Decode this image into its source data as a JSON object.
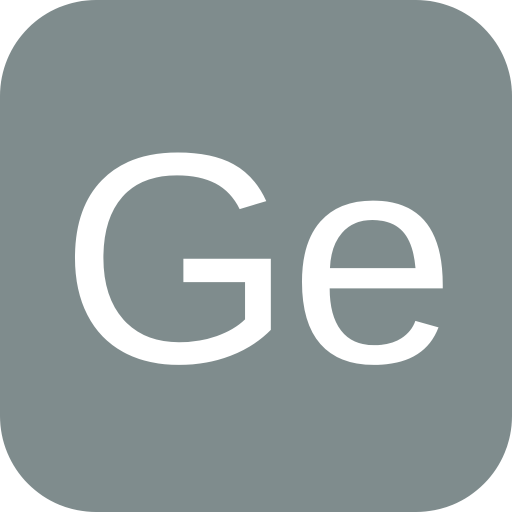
{
  "icon": {
    "label": "Ge",
    "background_color": "#7f8c8d",
    "text_color": "#ffffff"
  }
}
